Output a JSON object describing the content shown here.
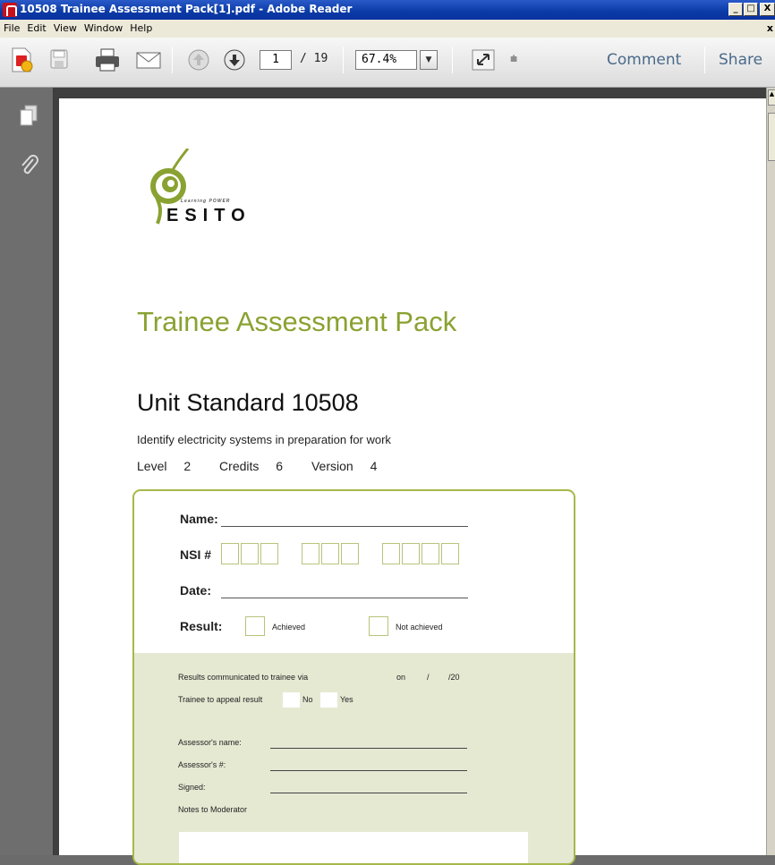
{
  "window": {
    "title": "10508 Trainee Assessment Pack[1].pdf - Adobe Reader",
    "minimize_label": "_",
    "restore_label": "□",
    "close_label": "X"
  },
  "menu": {
    "items": [
      "File",
      "Edit",
      "View",
      "Window",
      "Help"
    ],
    "doc_close": "x"
  },
  "toolbar": {
    "current_page": "1",
    "page_total": "/ 19",
    "zoom": "67.4%",
    "dropdown_arrow": "▼",
    "overflow": "⩧",
    "comment_label": "Comment",
    "share_label": "Share"
  },
  "document": {
    "logo_tagline": "Learning POWER",
    "logo_word": "ESITO",
    "title": "Trainee Assessment Pack",
    "unit_standard": "Unit Standard 10508",
    "subtitle": "Identify electricity systems in preparation for work",
    "level_label": "Level",
    "level_value": "2",
    "credits_label": "Credits",
    "credits_value": "6",
    "version_label": "Version",
    "version_value": "4",
    "form": {
      "name_label": "Name:",
      "nsi_label": "NSI #",
      "date_label": "Date:",
      "result_label": "Result:",
      "achieved_label": "Achieved",
      "not_achieved_label": "Not achieved",
      "results_communicated": "Results communicated to trainee via",
      "on_label": "on",
      "slash": "/",
      "year_prefix": "/20",
      "appeal_label": "Trainee to appeal result",
      "no_label": "No",
      "yes_label": "Yes",
      "assessor_name_label": "Assessor's name:",
      "assessor_num_label": "Assessor's #:",
      "signed_label": "Signed:",
      "notes_label": "Notes to Moderator"
    }
  },
  "colors": {
    "accent_green": "#8aa232",
    "card_border": "#a6b84a",
    "card_fill": "#e5e9d2",
    "toolbar_link": "#4a6a8a"
  }
}
